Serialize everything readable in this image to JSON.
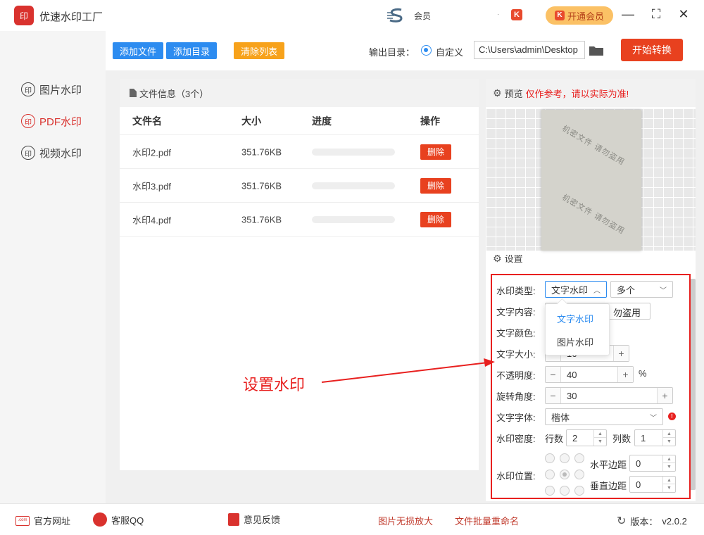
{
  "app": {
    "logo_text": "印",
    "title": "优速水印工厂",
    "member_label": "会员",
    "user_dot": "·",
    "k_badge": "K",
    "vip_button": "开通会员",
    "minimize": "—",
    "maximize": "⛶",
    "close": "✕"
  },
  "sidebar": {
    "items": [
      {
        "icon": "印",
        "label": "图片水印",
        "active": false
      },
      {
        "icon": "印",
        "label": "PDF水印",
        "active": true
      },
      {
        "icon": "印",
        "label": "视频水印",
        "active": false
      }
    ]
  },
  "toolbar": {
    "add_file": "添加文件",
    "add_dir": "添加目录",
    "clear_list": "清除列表",
    "output_label": "输出目录：",
    "radio_label": "自定义",
    "output_path": "C:\\Users\\admin\\Desktop",
    "start": "开始转换"
  },
  "file_panel": {
    "header": "文件信息（3个）",
    "columns": {
      "name": "文件名",
      "size": "大小",
      "progress": "进度",
      "action": "操作"
    },
    "rows": [
      {
        "name": "水印2.pdf",
        "size": "351.76KB",
        "progress": 0,
        "action": "删除"
      },
      {
        "name": "水印3.pdf",
        "size": "351.76KB",
        "progress": 0,
        "action": "删除"
      },
      {
        "name": "水印4.pdf",
        "size": "351.76KB",
        "progress": 0,
        "action": "删除"
      }
    ]
  },
  "preview": {
    "label": "预览",
    "note": "仅作参考，请以实际为准!",
    "watermark_text": "机密文件 请勿盗用"
  },
  "settings": {
    "header": "设置",
    "type_label": "水印类型:",
    "type_value": "文字水印",
    "multi_value": "多个",
    "content_label": "文字内容:",
    "content_value": "勿盗用",
    "color_label": "文字颜色:",
    "size_label": "文字大小:",
    "size_value": "16",
    "opacity_label": "不透明度:",
    "opacity_value": "40",
    "opacity_unit": "%",
    "rotate_label": "旋转角度:",
    "rotate_value": "30",
    "font_label": "文字字体:",
    "font_value": "楷体",
    "density_label": "水印密度:",
    "rows_label": "行数",
    "rows_value": "2",
    "cols_label": "列数",
    "cols_value": "1",
    "position_label": "水印位置:",
    "h_margin_label": "水平边距",
    "h_margin_value": "0",
    "v_margin_label": "垂直边距",
    "v_margin_value": "0",
    "dropdown_options": [
      "文字水印",
      "图片水印"
    ],
    "minus": "−",
    "plus": "+",
    "warn": "!"
  },
  "annotation": {
    "text": "设置水印",
    "color": "#e8201f"
  },
  "footer": {
    "website": "官方网址",
    "service": "客服QQ",
    "feedback": "意见反馈",
    "upscale": "图片无损放大",
    "rename": "文件批量重命名",
    "version_label": "版本：",
    "version": "v2.0.2",
    "com_text": ".com"
  },
  "colors": {
    "accent_red": "#e8411f",
    "accent_blue": "#2d8cf0",
    "accent_orange": "#f7a21b"
  }
}
